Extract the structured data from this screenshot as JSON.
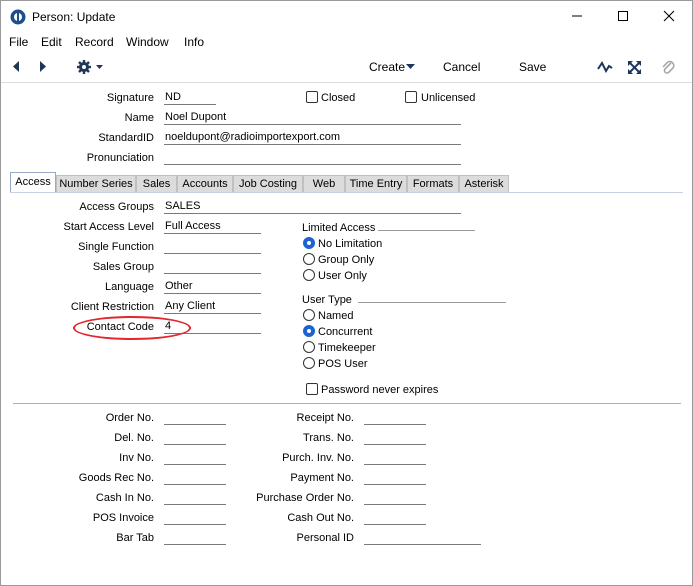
{
  "window": {
    "title": "Person: Update"
  },
  "menu": [
    "File",
    "Edit",
    "Record",
    "Window",
    "Info"
  ],
  "toolbar": {
    "create": "Create",
    "cancel": "Cancel",
    "save": "Save"
  },
  "header": {
    "signature_label": "Signature",
    "signature": "ND",
    "closed_label": "Closed",
    "unlicensed_label": "Unlicensed",
    "name_label": "Name",
    "name": "Noel Dupont",
    "standardid_label": "StandardID",
    "standardid": "noeldupont@radioimportexport.com",
    "pronunciation_label": "Pronunciation",
    "pronunciation": ""
  },
  "tabs": [
    "Access",
    "Number Series",
    "Sales",
    "Accounts",
    "Job Costing",
    "Web",
    "Time Entry",
    "Formats",
    "Asterisk"
  ],
  "access": {
    "access_groups_label": "Access Groups",
    "access_groups": "SALES",
    "start_level_label": "Start Access Level",
    "start_level": "Full Access",
    "single_function_label": "Single Function",
    "single_function": "",
    "sales_group_label": "Sales Group",
    "sales_group": "",
    "language_label": "Language",
    "language": "Other",
    "client_restriction_label": "Client Restriction",
    "client_restriction": "Any Client",
    "contact_code_label": "Contact Code",
    "contact_code": "4"
  },
  "limited_access": {
    "title": "Limited Access",
    "options": [
      "No Limitation",
      "Group Only",
      "User Only"
    ],
    "selected": "No Limitation"
  },
  "user_type": {
    "title": "User Type",
    "options": [
      "Named",
      "Concurrent",
      "Timekeeper",
      "POS User"
    ],
    "selected": "Concurrent"
  },
  "password_never_expires": "Password never expires",
  "numbers_left": [
    "Order No.",
    "Del. No.",
    "Inv No.",
    "Goods Rec No.",
    "Cash In No.",
    "POS Invoice",
    "Bar Tab"
  ],
  "numbers_right": [
    "Receipt No.",
    "Trans. No.",
    "Purch. Inv. No.",
    "Payment No.",
    "Purchase Order No.",
    "Cash Out No.",
    "Personal ID"
  ]
}
